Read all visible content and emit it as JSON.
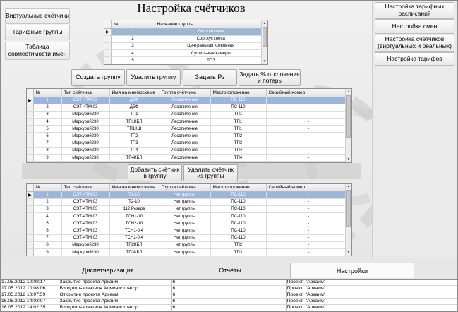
{
  "title": "Настройка счётчиков",
  "left_nav": [
    "Виртуальные счётчики",
    "Тарифные группы",
    "Таблица совместимости имён"
  ],
  "right_nav": [
    "Настройка тарифных расписаний",
    "Настройка смен",
    "Настройка счётчиков (виртуальных и реальных)",
    "Настройка тарифов"
  ],
  "groups_grid": {
    "headers": [
      "№",
      "Название группы"
    ],
    "rows": [
      [
        "1",
        "Лесопиление"
      ],
      [
        "2",
        "Сорт.куст.леса"
      ],
      [
        "3",
        "Центральная котельная"
      ],
      [
        "4",
        "Сушильные камеры"
      ],
      [
        "5",
        "ЛПЗ"
      ]
    ]
  },
  "group_buttons": [
    "Создать группу",
    "Удалить группу",
    "Задать Рз",
    "Задать % отклонения и потерь"
  ],
  "meter_headers": [
    "№",
    "Тип счётчика",
    "Имя на мнемосхеме",
    "Группа счётчика",
    "Местоположение",
    "Серийный номер"
  ],
  "meters_top": [
    [
      "1",
      "СЭТ-4ТМ.03",
      "ДБФ",
      "Лесопиление",
      "ПС-110",
      "-"
    ],
    [
      "2",
      "СЭТ-4ТМ.03",
      "ДБФ",
      "Лесопиление",
      "ПС-110",
      "-"
    ],
    [
      "3",
      "Меркурий230",
      "ТП1",
      "Лесопиление",
      "ТП1",
      "-"
    ],
    [
      "4",
      "Меркурий230",
      "ТП1КБЛ",
      "Лесопиление",
      "ТП1",
      "-"
    ],
    [
      "5",
      "Меркурий230",
      "ТП1КШ",
      "Лесопиление",
      "ТП1",
      "-"
    ],
    [
      "6",
      "Меркурий230",
      "ТП2",
      "Лесопиление",
      "ТП2",
      "-"
    ],
    [
      "7",
      "Меркурий230",
      "ТП3",
      "Лесопиление",
      "ТП3",
      "-"
    ],
    [
      "8",
      "Меркурий230",
      "ТП4",
      "Лесопиление",
      "ТП4",
      "-"
    ],
    [
      "9",
      "Меркурий230",
      "ТП4КБЛ",
      "Лесопиление",
      "ТП4",
      "-"
    ]
  ],
  "meter_buttons": [
    "Добавить счётчик в группу",
    "Удалить счётчик из группы"
  ],
  "meters_bottom": [
    [
      "1",
      "СЭТ-4ТМ.03",
      "Т1-10",
      "Нет группы",
      "ПС-110",
      "-"
    ],
    [
      "2",
      "СЭТ-4ТМ.03",
      "Т2-10",
      "Нет группы",
      "ПС-110",
      "-"
    ],
    [
      "3",
      "СЭТ-4ТМ.03",
      "112 Резерв",
      "Нет группы",
      "ПС-110",
      "-"
    ],
    [
      "4",
      "СЭТ-4ТМ.03",
      "ТСН1-10",
      "Нет группы",
      "ПС-110",
      "-"
    ],
    [
      "5",
      "СЭТ-4ТМ.03",
      "ТСН2-10",
      "Нет группы",
      "ПС-110",
      "-"
    ],
    [
      "6",
      "СЭТ-4ТМ.03",
      "ТСН1-0,4",
      "Нет группы",
      "ПС-110",
      "-"
    ],
    [
      "7",
      "СЭТ-4ТМ.03",
      "ТСН2-0,4",
      "Нет группы",
      "ПС-110",
      "-"
    ],
    [
      "8",
      "Меркурий230",
      "ТП2КБЛ",
      "Нет группы",
      "ТП2",
      "-"
    ],
    [
      "9",
      "Меркурий230",
      "ТП3КБЛ",
      "Нет группы",
      "ТП3",
      "-"
    ]
  ],
  "tabs": [
    "Диспетчеризация",
    "Отчёты",
    "Настройки"
  ],
  "log": [
    [
      "17.05.2012 10:08:17",
      "Закрытие проекта Аркаим",
      "6",
      "Проект: \"Аркаим\""
    ],
    [
      "17.05.2012 10:08:06",
      "Вход пользователя Администратор",
      "6",
      "Проект: \"Аркаим\""
    ],
    [
      "17.05.2012 10:07:59",
      "Открытие проекта Аркаим",
      "6",
      "Проект: \"Аркаим\""
    ],
    [
      "16.05.2012 14:03:07",
      "Закрытие проекта Аркаим",
      "6",
      "Проект: \"Аркаим\""
    ],
    [
      "16.05.2012 14:02:35",
      "Вход пользователя Администратор",
      "6",
      "Проект: \"Аркаим\""
    ],
    [
      "16.05.2012 14:02:30",
      "Открытие проекта Аркаим",
      "6",
      "Проект: \"Аркаим\""
    ]
  ]
}
